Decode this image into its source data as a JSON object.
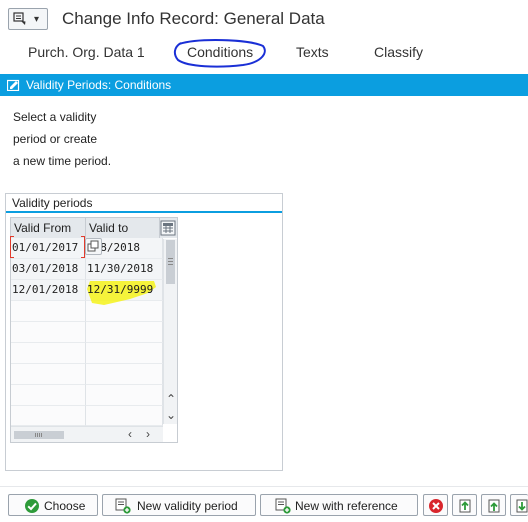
{
  "window": {
    "title": "Change Info Record: General Data"
  },
  "tabs": [
    {
      "label": "Purch. Org. Data 1",
      "active": false
    },
    {
      "label": "Conditions",
      "active": true
    },
    {
      "label": "Texts",
      "active": false
    },
    {
      "label": "Classify",
      "active": false
    }
  ],
  "section": {
    "title": "Validity Periods: Conditions"
  },
  "instructions": [
    "Select a validity",
    "period or create",
    "a new time period."
  ],
  "validity_table": {
    "group_title": "Validity periods",
    "columns": [
      "Valid From",
      "Valid to"
    ],
    "rows": [
      {
        "valid_from": "01/01/2017",
        "valid_to": "/28/2018"
      },
      {
        "valid_from": "03/01/2018",
        "valid_to": "11/30/2018"
      },
      {
        "valid_from": "12/01/2018",
        "valid_to": "12/31/9999"
      }
    ]
  },
  "toolbar": {
    "choose_label": "Choose",
    "new_period_label": "New validity period",
    "new_reference_label": "New with reference"
  },
  "colors": {
    "accent": "#0b9ee0",
    "annotation_circle": "#1a2fd6",
    "highlight": "#f4f21a"
  }
}
